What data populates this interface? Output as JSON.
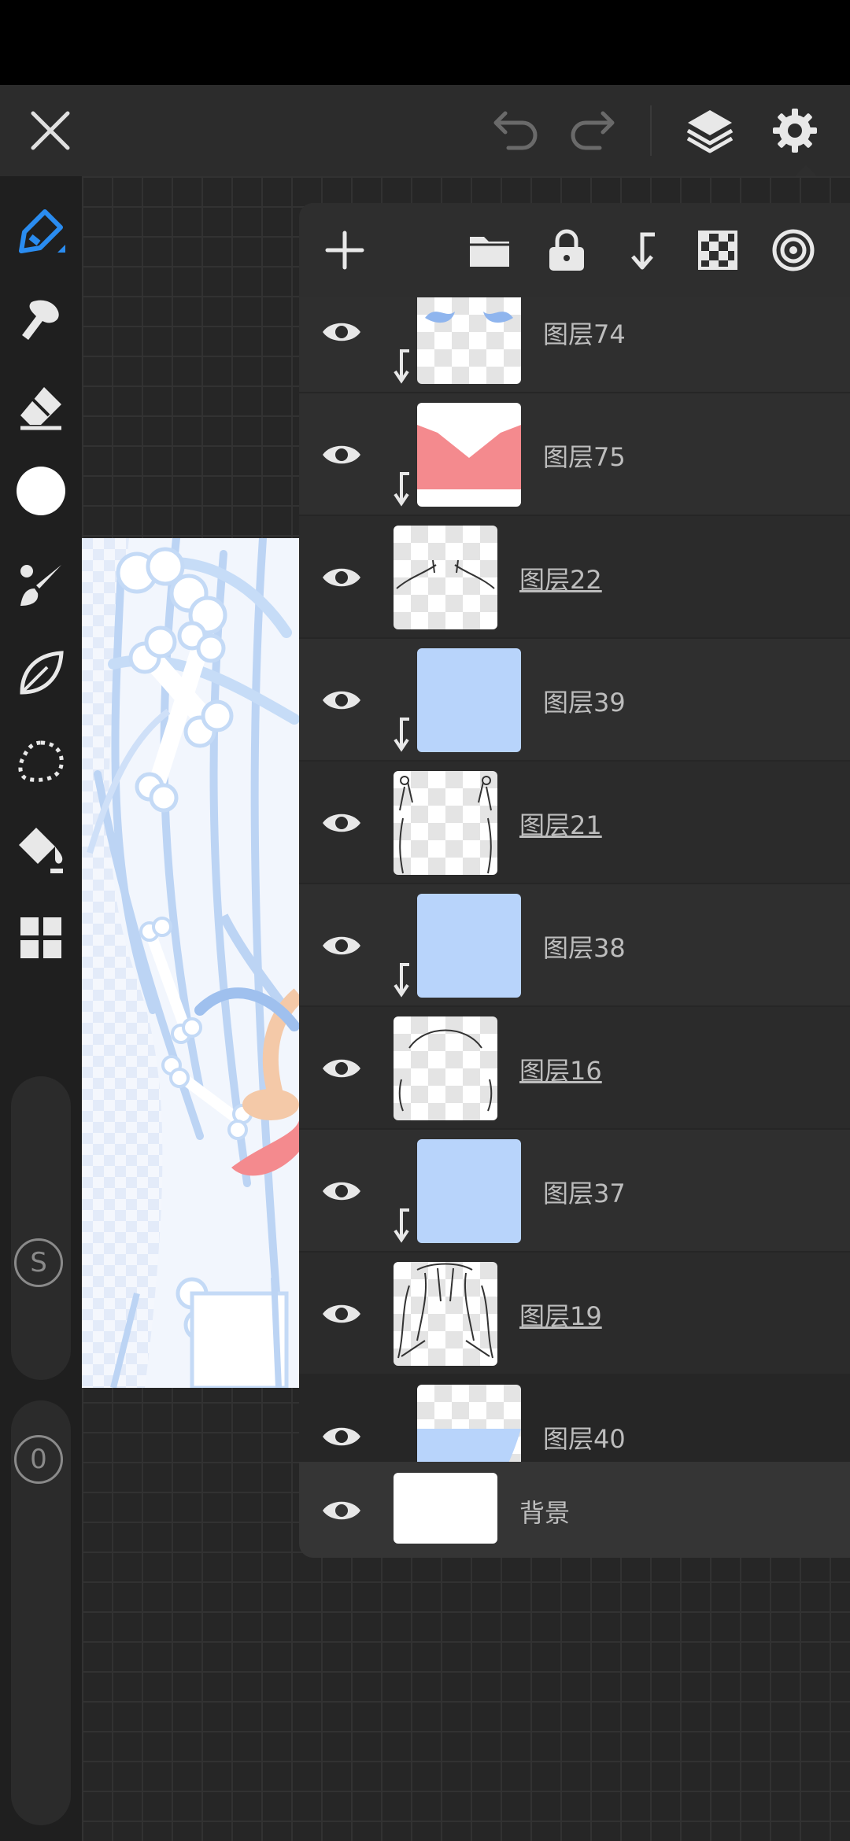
{
  "toolbar": {
    "close_label": "close",
    "undo_label": "undo",
    "redo_label": "redo",
    "layers_label": "layers",
    "settings_label": "settings"
  },
  "left_tools": [
    "pen",
    "smudge",
    "eraser",
    "color",
    "brush",
    "leaf",
    "lasso",
    "fill",
    "grid"
  ],
  "brush_color": "#ffffff",
  "sliders": {
    "size_label": "S",
    "opacity_label": "0"
  },
  "layers_toolbar": [
    "add",
    "folder",
    "lock",
    "clip",
    "transparency",
    "blend"
  ],
  "layers": [
    {
      "name": "图层74",
      "clipped": true,
      "thumb": "blue-marks"
    },
    {
      "name": "图层75",
      "clipped": true,
      "thumb": "pink-collar"
    },
    {
      "name": "图层22",
      "clipped": false,
      "thumb": "line-shoulders"
    },
    {
      "name": "图层39",
      "clipped": true,
      "thumb": "blue-fill"
    },
    {
      "name": "图层21",
      "clipped": false,
      "thumb": "line-bones"
    },
    {
      "name": "图层38",
      "clipped": true,
      "thumb": "blue-fill"
    },
    {
      "name": "图层16",
      "clipped": false,
      "thumb": "line-head"
    },
    {
      "name": "图层37",
      "clipped": true,
      "thumb": "blue-fill"
    },
    {
      "name": "图层19",
      "clipped": false,
      "thumb": "line-hair"
    },
    {
      "name": "图层40",
      "clipped": true,
      "thumb": "blue-partial"
    }
  ],
  "background_layer": {
    "name": "背景"
  },
  "colors": {
    "accent": "#2a8cf0",
    "layer_blue": "#b8d4fb",
    "layer_pink": "#f48a8e"
  }
}
